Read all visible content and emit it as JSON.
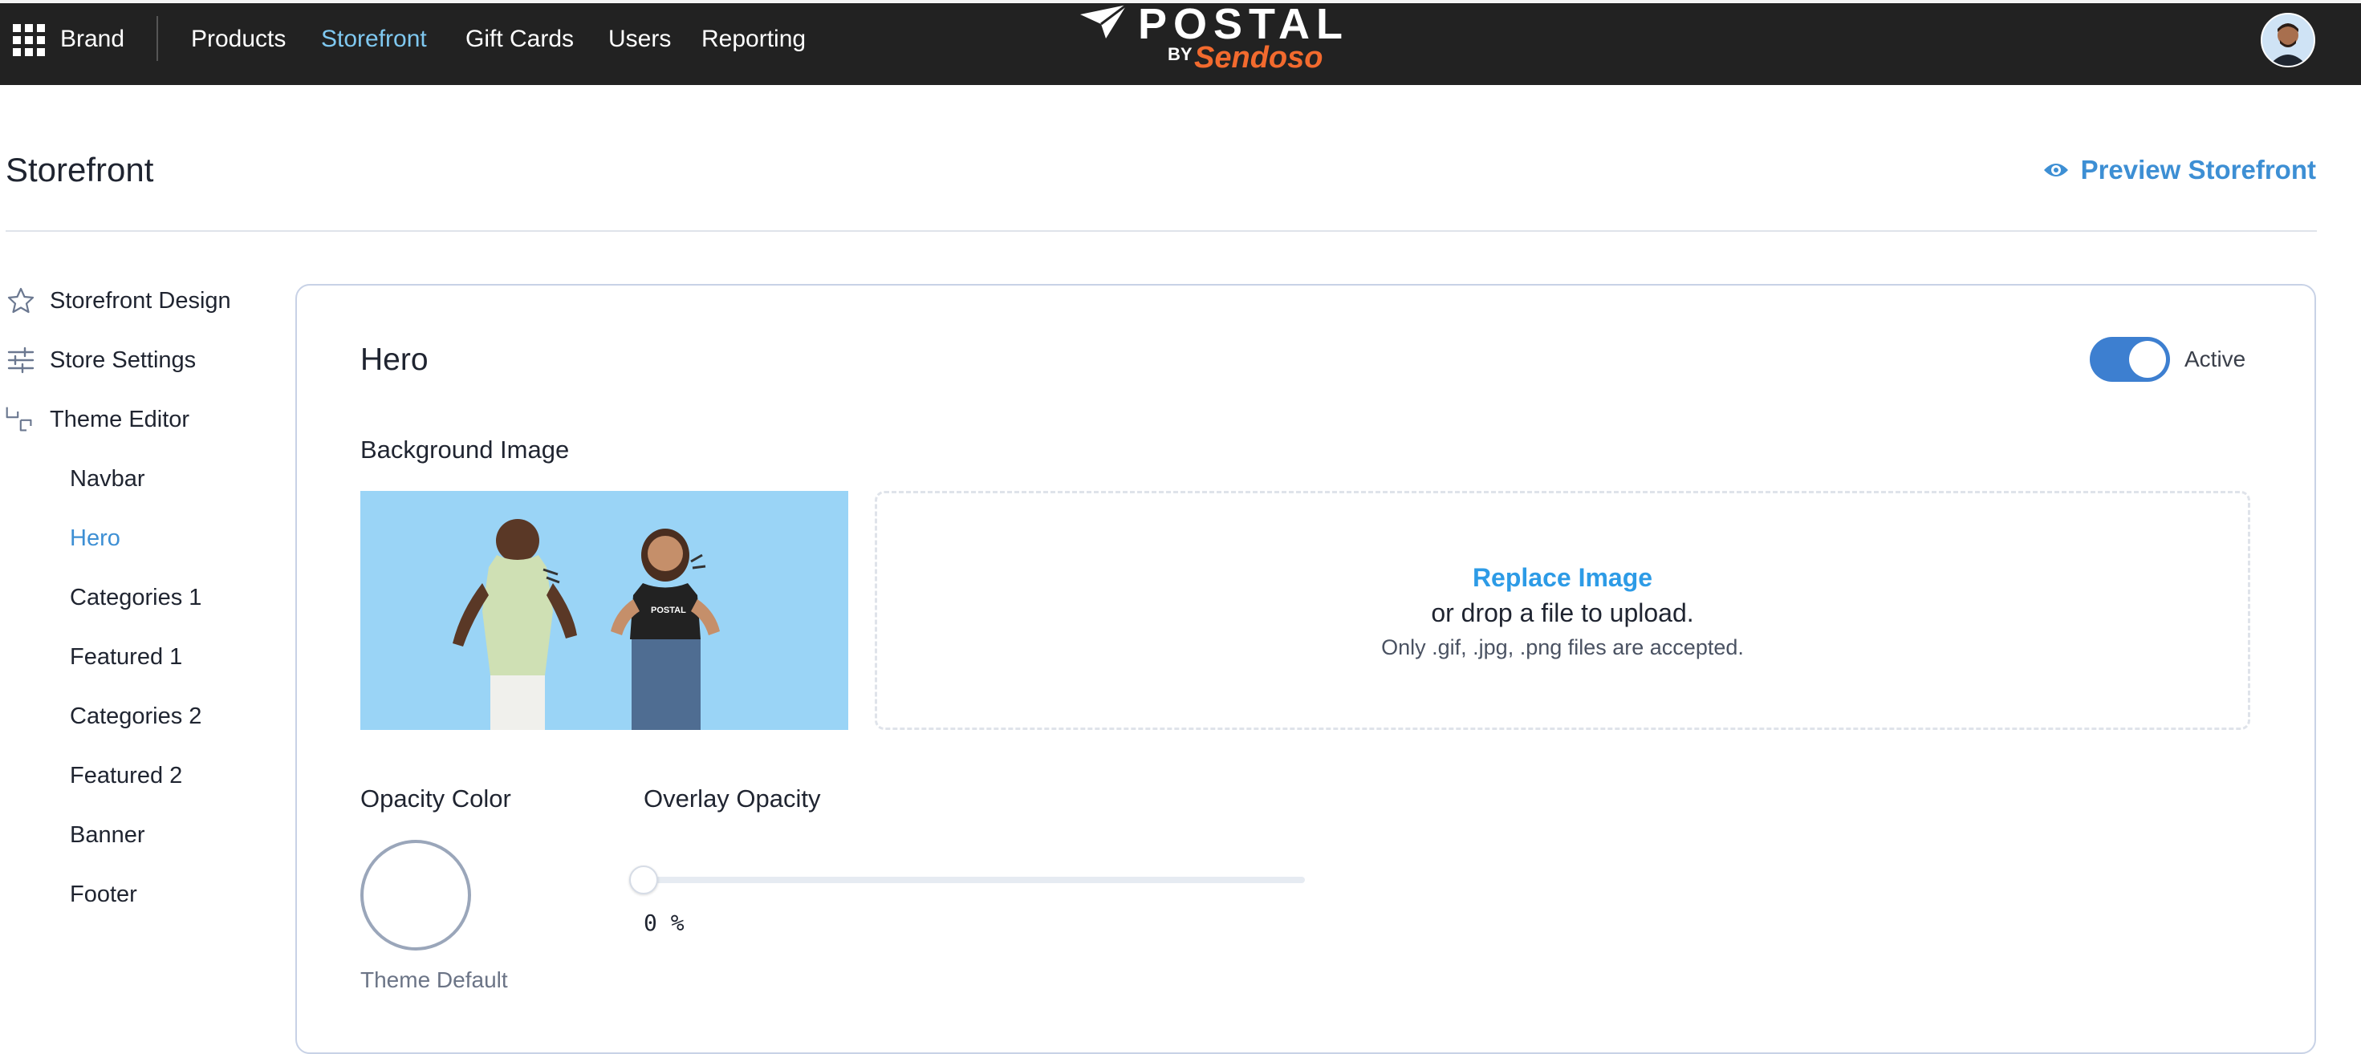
{
  "topnav": {
    "brand": "Brand",
    "items": [
      "Products",
      "Storefront",
      "Gift Cards",
      "Users",
      "Reporting"
    ],
    "active": "Storefront"
  },
  "logo": {
    "word": "POSTAL",
    "by": "BY",
    "partner": "Sendoso",
    "partner_color": "#f26a2e"
  },
  "page": {
    "title": "Storefront",
    "preview_label": "Preview Storefront"
  },
  "sidebar": {
    "items": [
      {
        "label": "Storefront Design",
        "icon": "star-icon"
      },
      {
        "label": "Store Settings",
        "icon": "sliders-icon"
      },
      {
        "label": "Theme Editor",
        "icon": "theme-editor-icon"
      }
    ],
    "sub_items": [
      "Navbar",
      "Hero",
      "Categories 1",
      "Featured 1",
      "Categories 2",
      "Featured 2",
      "Banner",
      "Footer"
    ],
    "active_sub": "Hero"
  },
  "section": {
    "title": "Hero",
    "toggle_label": "Active",
    "toggle_on": true,
    "background_label": "Background Image",
    "replace_link": "Replace Image",
    "drop_text": "or drop a file to upload.",
    "file_hint": "Only .gif, .jpg, .png files are accepted.",
    "opacity_color_label": "Opacity Color",
    "opacity_color_value": "Theme Default",
    "overlay_label": "Overlay Opacity",
    "overlay_value": 0,
    "overlay_display": "0 %"
  },
  "colors": {
    "accent": "#3d7fd0",
    "link": "#2d9be6",
    "nav_active": "#7fc8f0",
    "topbar": "#222222",
    "hero_bg": "#9ad4f6"
  }
}
